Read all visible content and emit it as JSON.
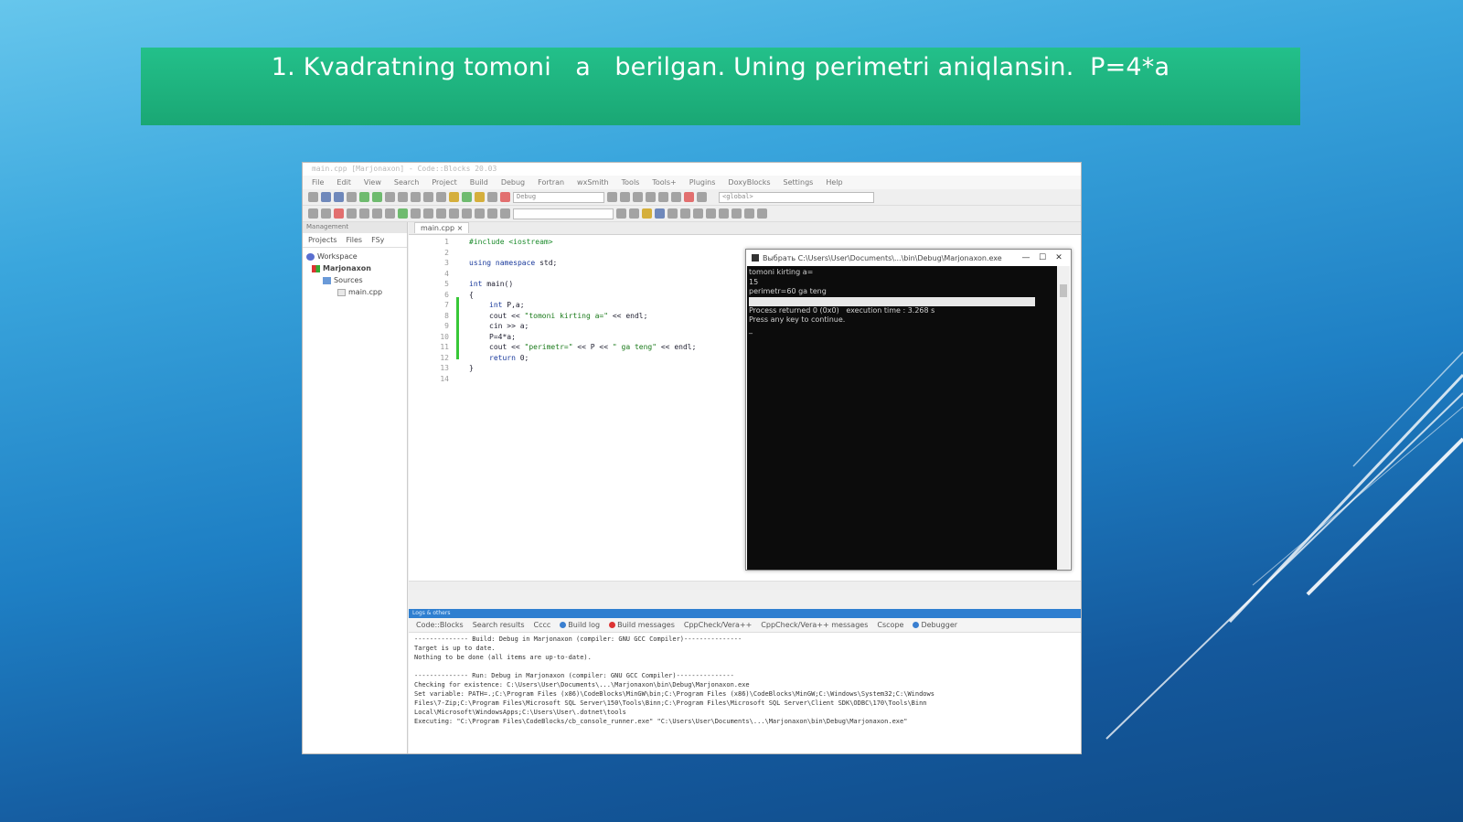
{
  "slide": {
    "title": "1. Kvadratning tomoni   a   berilgan. Uning perimetri aniqlansin.  P=4*a"
  },
  "ide": {
    "window_title": "main.cpp [Marjonaxon] - Code::Blocks 20.03",
    "menu": [
      "File",
      "Edit",
      "View",
      "Search",
      "Project",
      "Build",
      "Debug",
      "Fortran",
      "wxSmith",
      "Tools",
      "Tools+",
      "Plugins",
      "DoxyBlocks",
      "Settings",
      "Help"
    ],
    "target_combo": "Debug",
    "scope_combo": "<global>",
    "management": {
      "header": "Management",
      "tabs": [
        "Projects",
        "Files",
        "FSy"
      ],
      "tree": {
        "workspace": "Workspace",
        "project": "Marjonaxon",
        "folder": "Sources",
        "file": "main.cpp"
      }
    },
    "editor": {
      "tab": "main.cpp",
      "line_numbers": [
        "1",
        "2",
        "3",
        "4",
        "5",
        "6",
        "7",
        "8",
        "9",
        "10",
        "11",
        "12",
        "13",
        "14"
      ],
      "code": {
        "l1": "#include <iostream>",
        "l3_kw": "using namespace",
        "l3_rest": " std;",
        "l5_kw": "int",
        "l5_rest": " main()",
        "l6": "{",
        "l7_kw": "int",
        "l7_rest": " P,a;",
        "l8_a": "cout << ",
        "l8_str": "\"tomoni kirting a=\"",
        "l8_b": " << endl;",
        "l9": "cin >> a;",
        "l10": "P=4*a;",
        "l11_a": "cout << ",
        "l11_str1": "\"perimetr=\"",
        "l11_b": " << P << ",
        "l11_str2": "\" ga teng\"",
        "l11_c": " << endl;",
        "l12_kw": "return",
        "l12_rest": " 0;",
        "l13": "}"
      }
    },
    "console": {
      "title": "Выбрать  C:\\Users\\User\\Documents\\...\\bin\\Debug\\Marjonaxon.exe",
      "minimize": "—",
      "maximize": "☐",
      "close": "✕",
      "lines": {
        "l1": "tomoni kirting a=",
        "l2": "15",
        "l3": "perimetr=60 ga teng",
        "l4": "",
        "l5": "Process returned 0 (0x0)   execution time : 3.268 s",
        "l6": "Press any key to continue.",
        "l7": "_"
      }
    },
    "logs": {
      "header": "Logs & others",
      "tabs": [
        "Code::Blocks",
        "Search results",
        "Cccc",
        "Build log",
        "Build messages",
        "CppCheck/Vera++",
        "CppCheck/Vera++ messages",
        "Cscope",
        "Debugger"
      ],
      "lines": [
        "-------------- Build: Debug in Marjonaxon (compiler: GNU GCC Compiler)---------------",
        "Target is up to date.",
        "Nothing to be done (all items are up-to-date).",
        "",
        "-------------- Run: Debug in Marjonaxon (compiler: GNU GCC Compiler)---------------",
        "Checking for existence: C:\\Users\\User\\Documents\\...\\Marjonaxon\\bin\\Debug\\Marjonaxon.exe",
        "Set variable: PATH=.;C:\\Program Files (x86)\\CodeBlocks\\MinGW\\bin;C:\\Program Files (x86)\\CodeBlocks\\MinGW;C:\\Windows\\System32;C:\\Windows",
        "Files\\7-Zip;C:\\Program Files\\Microsoft SQL Server\\150\\Tools\\Binn;C:\\Program Files\\Microsoft SQL Server\\Client SDK\\ODBC\\170\\Tools\\Binn",
        "Local\\Microsoft\\WindowsApps;C:\\Users\\User\\.dotnet\\tools",
        "Executing: \"C:\\Program Files\\CodeBlocks/cb_console_runner.exe\" \"C:\\Users\\User\\Documents\\...\\Marjonaxon\\bin\\Debug\\Marjonaxon.exe\""
      ]
    }
  },
  "colors": {
    "title_bar": "#1fb47f",
    "background_top": "#66c6ec",
    "background_bottom": "#0f4a86",
    "console_bg": "#0c0c0c"
  }
}
